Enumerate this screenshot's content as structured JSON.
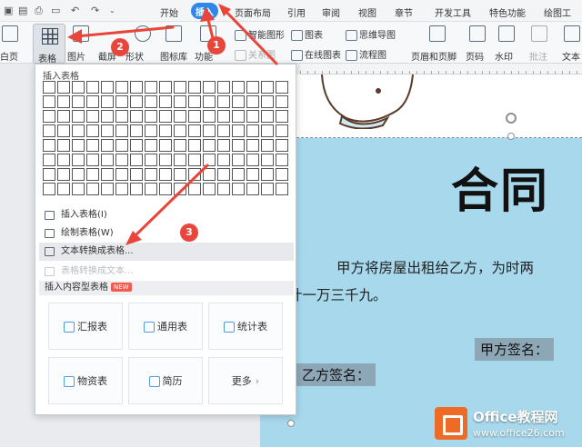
{
  "ribbon": {
    "tabs": [
      "开始",
      "插入",
      "页面布局",
      "引用",
      "审阅",
      "视图",
      "章节",
      "开发工具",
      "特色功能",
      "绘图工"
    ],
    "active_tab": "插入"
  },
  "toolbar": {
    "blank_page": "白页",
    "table": "表格",
    "picture": "图片",
    "screenshot": "截屏",
    "shapes": "形状",
    "icon_lib": "图标库",
    "function": "功能",
    "smart_art": "智能图形",
    "relation": "关系图",
    "chart": "图表",
    "online_chart": "在线图表",
    "mind_map": "思维导图",
    "flowchart": "流程图",
    "header_footer": "页眉和页脚",
    "page_number": "页码",
    "watermark": "水印",
    "comment": "批注",
    "text_box": "文本"
  },
  "dropdown": {
    "title": "插入表格",
    "items": [
      {
        "label": "插入表格(I)",
        "icon": "table-icon"
      },
      {
        "label": "绘制表格(W)",
        "icon": "pencil-icon"
      },
      {
        "label": "文本转换成表格...",
        "icon": "convert-icon"
      },
      {
        "label": "表格转换成文本...",
        "icon": "convert-text-icon"
      }
    ],
    "content_section": "插入内容型表格",
    "new_badge": "NEW",
    "cards": [
      "汇报表",
      "通用表",
      "统计表",
      "物资表",
      "简历",
      "更多"
    ]
  },
  "document": {
    "title": "合同",
    "body_line1": "甲方将房屋出租给乙方，为时两",
    "body_line2": "用共计一万三千九。",
    "sign_a": "甲方签名：",
    "sign_b": "乙方签名："
  },
  "annotations": [
    "1",
    "2",
    "3"
  ],
  "watermark": {
    "name": "Office教程网",
    "url": "www.office26.com"
  },
  "colors": {
    "accent": "#2e88ec",
    "arrow": "#e8463b",
    "page_bg": "#a8d8ec",
    "highlight_bg": "#8ea7b6",
    "watermark_logo": "#ee6a27"
  }
}
